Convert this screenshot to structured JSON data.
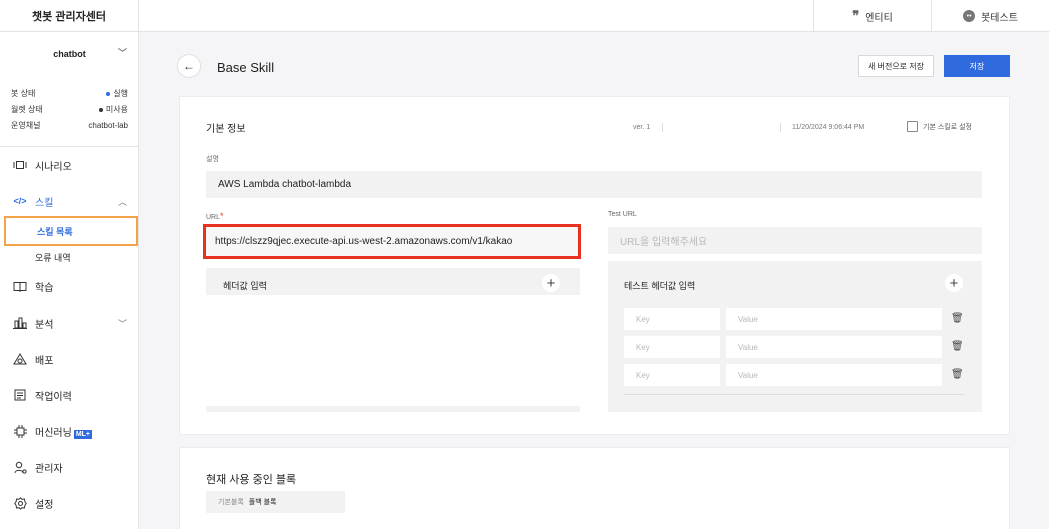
{
  "app": {
    "title": "챗봇 관리자센터"
  },
  "topbar": {
    "entity_label": "엔티티",
    "bottest_label": "봇테스트",
    "entity_icon": "quote-icon",
    "bottest_icon": "chat-bubble-icon"
  },
  "sidebar": {
    "bot_name": "chatbot",
    "status": [
      {
        "label": "봇 상태",
        "value": "실행",
        "dot_color": "#2f6bde"
      },
      {
        "label": "월렛 상태",
        "value": "미사용",
        "dot_color": "#333333"
      },
      {
        "label": "운영채널",
        "value": "chatbot-lab"
      }
    ],
    "nav": [
      {
        "label": "시나리오",
        "icon": "scenario-icon"
      },
      {
        "label": "스킬",
        "icon": "code-icon"
      },
      {
        "label": "학습",
        "icon": "book-icon"
      },
      {
        "label": "분석",
        "icon": "analytics-icon"
      },
      {
        "label": "배포",
        "icon": "deploy-icon"
      },
      {
        "label": "작업이력",
        "icon": "history-icon"
      },
      {
        "label": "머신러닝",
        "icon": "chip-icon",
        "badge": "ML+"
      },
      {
        "label": "관리자",
        "icon": "admin-icon"
      },
      {
        "label": "설정",
        "icon": "gear-icon"
      }
    ],
    "skill_sub": [
      {
        "label": "스킬 목록"
      },
      {
        "label": "오류 내역"
      }
    ]
  },
  "header": {
    "title": "Base Skill",
    "new_version_save": "새 버전으로 저장",
    "save": "저장"
  },
  "basic_info": {
    "title": "기본 정보",
    "version": "ver. 1",
    "date": "11/20/2024 9:06:44 PM",
    "default_skill_label": "기본 스킬로 설정",
    "default_skill_checked": false,
    "description_label": "설명",
    "description_value": "AWS Lambda chatbot-lambda",
    "url_label": "URL",
    "url_required_mark": "*",
    "url_value": "https://clszz9qjec.execute-api.us-west-2.amazonaws.com/v1/kakao",
    "test_url_label": "Test URL",
    "test_url_placeholder": "URL을 입력해주세요",
    "header_input_title": "헤더값 입력",
    "test_header_input_title": "테스트 헤더값 입력",
    "key_placeholder": "Key",
    "value_placeholder": "Value"
  },
  "blocks": {
    "title": "현재 사용 중인 블록",
    "chip_key": "기본블록",
    "chip_value": "폴백 블록"
  }
}
